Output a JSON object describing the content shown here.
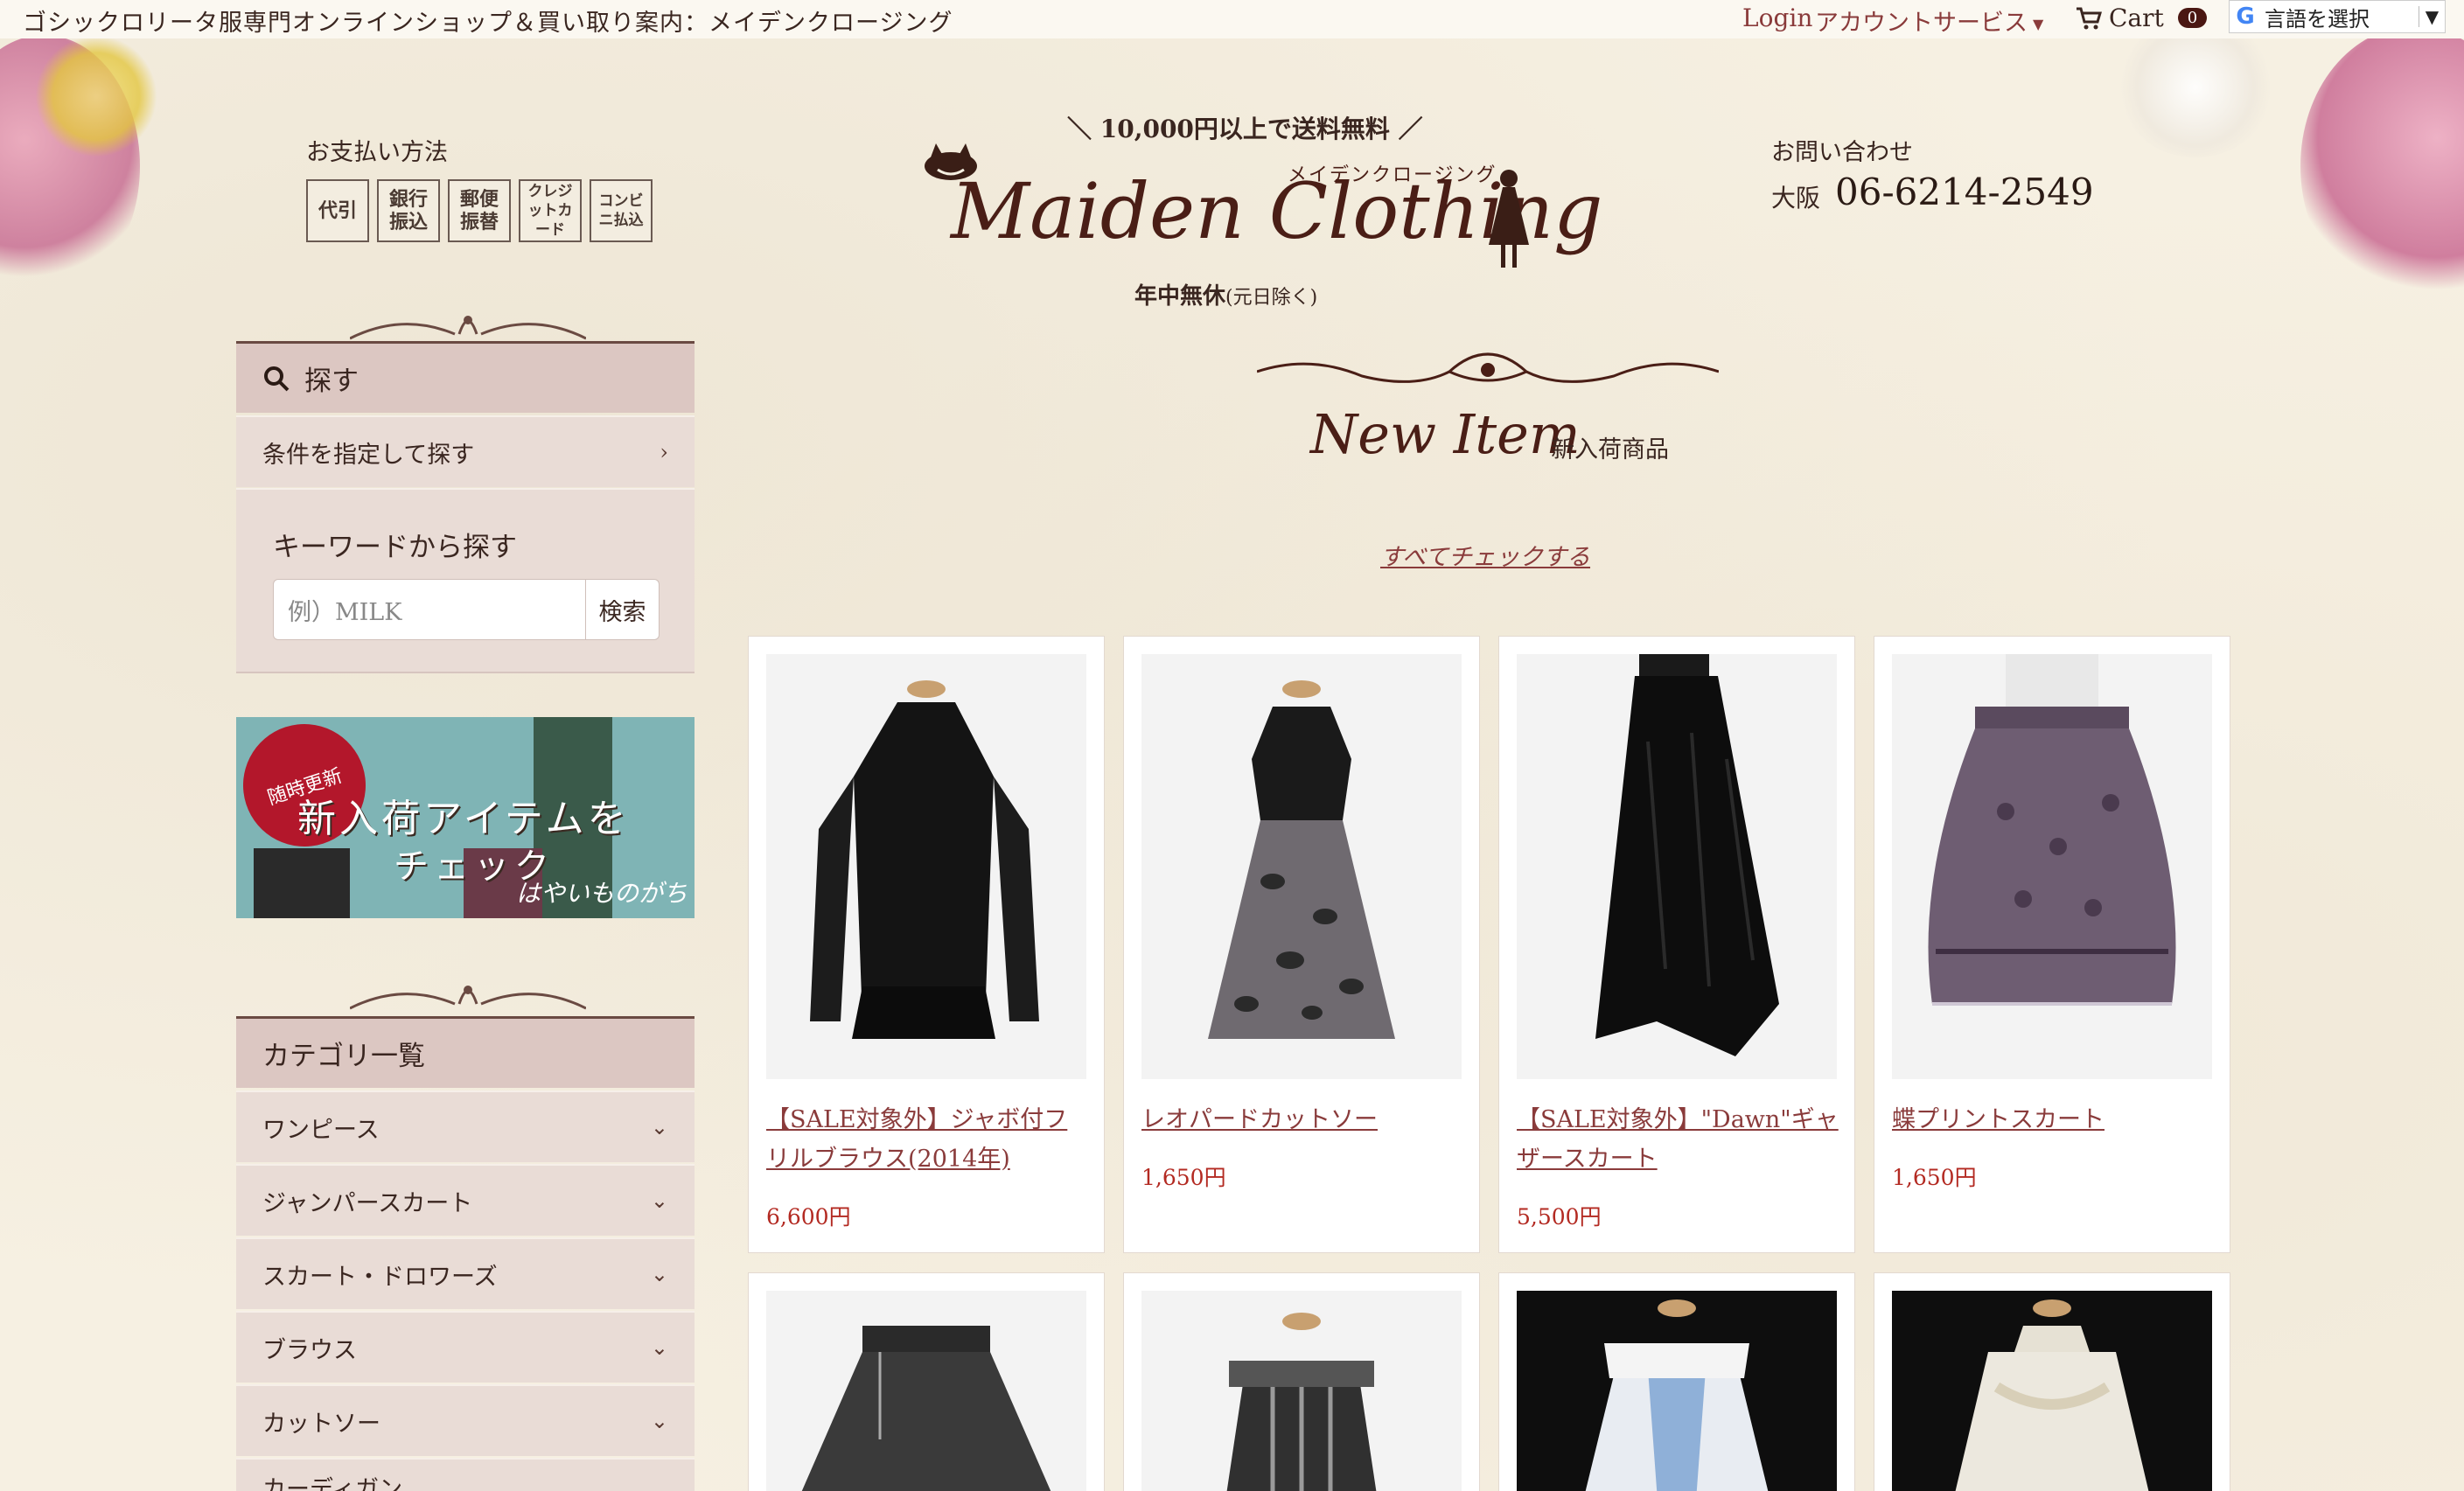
{
  "topbar": {
    "tagline": "ゴシックロリータ服専門オンラインショップ＆買い取り案内：メイデンクロージング",
    "login": "Login",
    "account": "アカウントサービス",
    "cart": "Cart",
    "cart_count": "0",
    "language": "言語を選択"
  },
  "header": {
    "payment_title": "お支払い方法",
    "payment_methods": [
      "代引",
      "銀行振込",
      "郵便振替",
      "クレジットカード",
      "コンビニ払込"
    ],
    "shipping_note": "＼ 10,000円以上で送料無料 ／",
    "logo_text": "Maiden Clothing",
    "logo_kana": "メイデンクロージング",
    "hours_main": "年中無休",
    "hours_note": "(元日除く)",
    "contact_title": "お問い合わせ",
    "contact_city": "大阪",
    "contact_phone": "06-6214-2549"
  },
  "sidebar": {
    "search_title": "探す",
    "search_conditions": "条件を指定して探す",
    "keyword_title": "キーワードから探す",
    "keyword_placeholder": "例）MILK",
    "keyword_button": "検索",
    "banner": {
      "seal": "随時更新",
      "title": "新入荷アイテムを",
      "subtitle": "チェック",
      "tag": "はやいものがち"
    },
    "category_title": "カテゴリ一覧",
    "categories": [
      "ワンピース",
      "ジャンパースカート",
      "スカート・ドロワーズ",
      "ブラウス",
      "カットソー",
      "カーディガン"
    ]
  },
  "main": {
    "section_title": "New Item",
    "section_sub": "新入荷商品",
    "check_all": "すべてチェックする",
    "products": [
      {
        "name": "【SALE対象外】ジャボ付フリルブラウス(2014年)",
        "price": "6,600円"
      },
      {
        "name": "レオパードカットソー",
        "price": "1,650円"
      },
      {
        "name": "【SALE対象外】\"Dawn\"ギャザースカート",
        "price": "5,500円"
      },
      {
        "name": "蝶プリントスカート",
        "price": "1,650円"
      }
    ]
  },
  "colors": {
    "accent": "#8a3b3b",
    "price": "#b32a22",
    "sidebar_head": "#dcc7c2",
    "sidebar_row": "#e9dcd6",
    "background": "#f6f0e2"
  }
}
